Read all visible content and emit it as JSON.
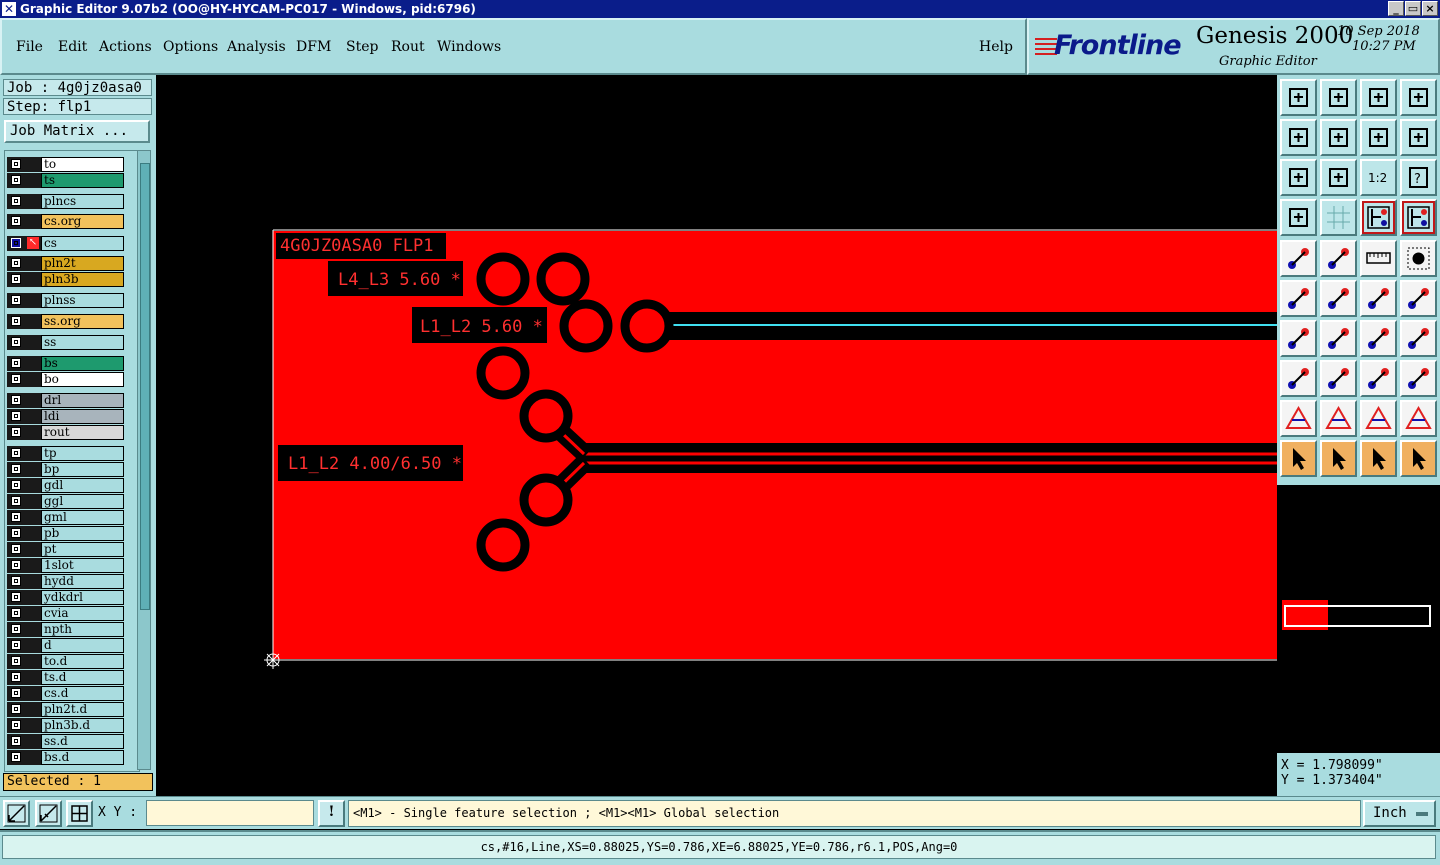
{
  "window": {
    "title": "Graphic Editor 9.07b2 (OO@HY-HYCAM-PC017 - Windows, pid:6796)",
    "controls": [
      "_",
      "▭",
      "×"
    ]
  },
  "menu": {
    "items": [
      "File",
      "Edit",
      "Actions",
      "Options",
      "Analysis",
      "DFM",
      "Step",
      "Rout",
      "Windows"
    ],
    "help": "Help"
  },
  "brand": {
    "logo": "Frontline",
    "product": "Genesis 2000",
    "subtitle": "Graphic Editor",
    "date": "10 Sep 2018",
    "time": "10:27 PM"
  },
  "left": {
    "job": "Job : 4g0jz0asa0",
    "step": "Step: flp1",
    "job_matrix": "Job Matrix ...",
    "selected": "Selected : 1",
    "layers": [
      {
        "name": "to",
        "color": "#ffffff"
      },
      {
        "name": "ts",
        "color": "#1e9a6e"
      },
      {
        "name": "plncs",
        "color": "#a9dcdf"
      },
      {
        "name": "cs.org",
        "color": "#f2c25c"
      },
      {
        "name": "cs",
        "color": "#a9dcdf",
        "active": true
      },
      {
        "name": "pln2t",
        "color": "#d8a820"
      },
      {
        "name": "pln3b",
        "color": "#d8a820"
      },
      {
        "name": "plnss",
        "color": "#a9dcdf"
      },
      {
        "name": "ss.org",
        "color": "#f2c25c"
      },
      {
        "name": "ss",
        "color": "#a9dcdf"
      },
      {
        "name": "bs",
        "color": "#1e9a6e"
      },
      {
        "name": "bo",
        "color": "#ffffff"
      },
      {
        "name": "drl",
        "color": "#a8b4bc"
      },
      {
        "name": "ldi",
        "color": "#a8b4bc"
      },
      {
        "name": "rout",
        "color": "#d8d8d8"
      },
      {
        "name": "tp",
        "color": "#a9dcdf"
      },
      {
        "name": "bp",
        "color": "#a9dcdf"
      },
      {
        "name": "gdl",
        "color": "#a9dcdf"
      },
      {
        "name": "ggl",
        "color": "#a9dcdf"
      },
      {
        "name": "gml",
        "color": "#a9dcdf"
      },
      {
        "name": "pb",
        "color": "#a9dcdf"
      },
      {
        "name": "pt",
        "color": "#a9dcdf"
      },
      {
        "name": "1slot",
        "color": "#a9dcdf"
      },
      {
        "name": "hydd",
        "color": "#a9dcdf"
      },
      {
        "name": "ydkdrl",
        "color": "#a9dcdf"
      },
      {
        "name": "cvia",
        "color": "#a9dcdf"
      },
      {
        "name": "npth",
        "color": "#a9dcdf"
      },
      {
        "name": "d",
        "color": "#a9dcdf"
      },
      {
        "name": "to.d",
        "color": "#a9dcdf"
      },
      {
        "name": "ts.d",
        "color": "#a9dcdf"
      },
      {
        "name": "cs.d",
        "color": "#a9dcdf"
      },
      {
        "name": "pln2t.d",
        "color": "#a9dcdf"
      },
      {
        "name": "pln3b.d",
        "color": "#a9dcdf"
      },
      {
        "name": "ss.d",
        "color": "#a9dcdf"
      },
      {
        "name": "bs.d",
        "color": "#a9dcdf"
      }
    ]
  },
  "canvas": {
    "step_label": "4G0JZ0ASA0 FLP1",
    "labels": [
      "L4_L3 5.60 *",
      "L1_L2 5.60 *",
      "L1_L2 4.00/6.50 *"
    ],
    "layer_color": "#ff0000",
    "highlight_color": "#40e0f0"
  },
  "right": {
    "x": "X = 1.798099\"",
    "y": "Y = 1.373404\""
  },
  "bottom": {
    "xy_label": "X Y :",
    "xy_value": "",
    "bang": "!",
    "message": "<M1> - Single feature selection ; <M1><M1> Global selection",
    "unit": "Inch",
    "status": "cs,#16,Line,XS=0.88025,YS=0.786,XE=6.88025,YE=0.786,r6.1,POS,Ang=0"
  }
}
